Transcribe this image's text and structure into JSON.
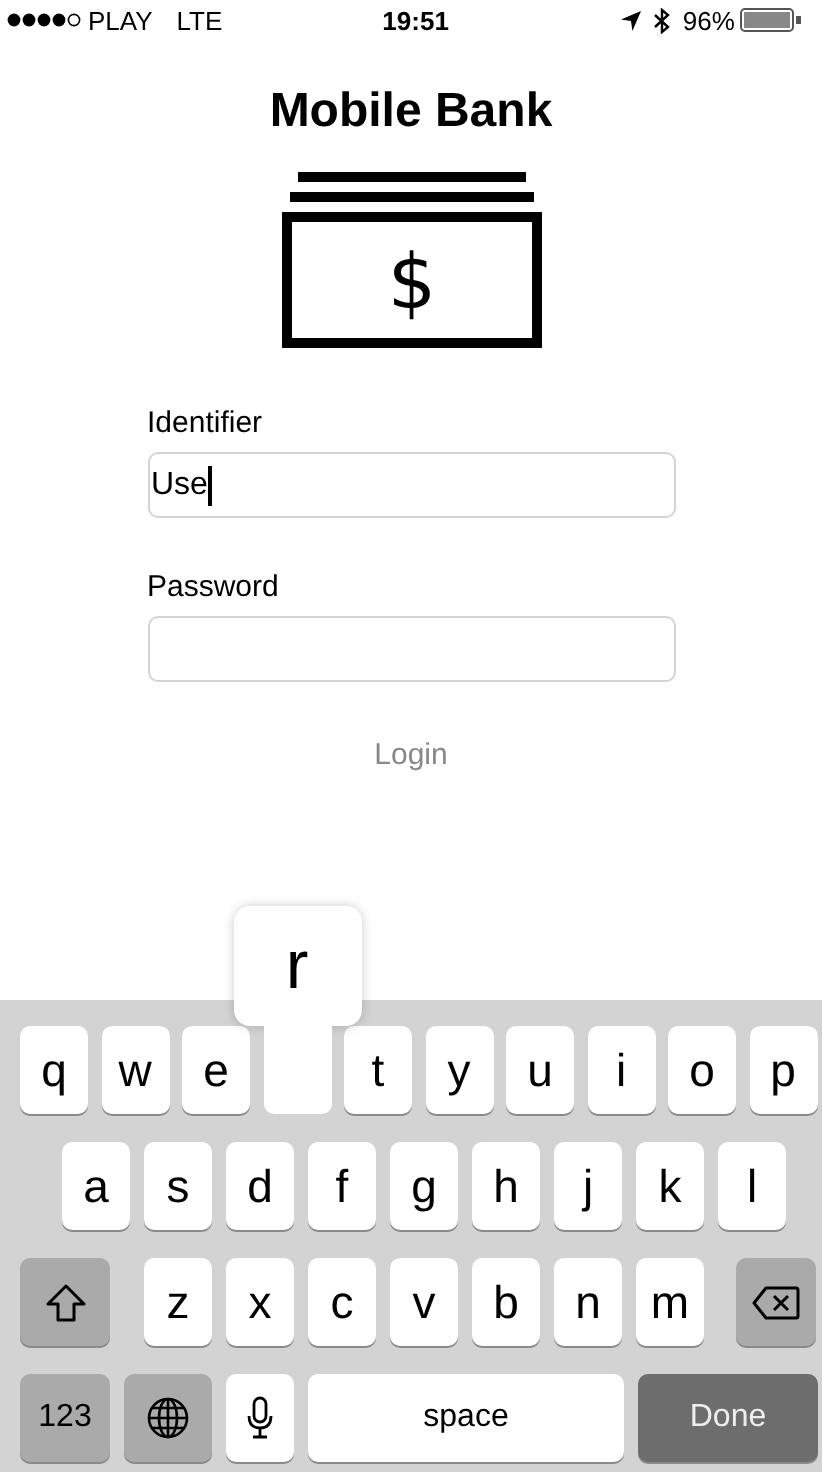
{
  "status_bar": {
    "carrier": "PLAY",
    "network": "LTE",
    "time": "19:51",
    "battery": "96%"
  },
  "title": "Mobile Bank",
  "logo_symbol": "$",
  "fields": [
    {
      "label": "Identifier",
      "value": "Use",
      "focused": true
    },
    {
      "label": "Password",
      "focused": false
    }
  ],
  "login_button": "Login",
  "keyboard": {
    "top_row": [
      {
        "kind": "letter",
        "label": "q",
        "pressed": false
      },
      {
        "kind": "letter",
        "label": "w",
        "pressed": false
      },
      {
        "kind": "letter",
        "label": "e",
        "pressed": false
      },
      {
        "kind": "letter",
        "label": "r",
        "pressed": true
      },
      {
        "kind": "letter",
        "label": "t",
        "pressed": false
      },
      {
        "kind": "letter",
        "label": "y",
        "pressed": false
      },
      {
        "kind": "letter",
        "label": "u",
        "pressed": false
      },
      {
        "kind": "letter",
        "label": "i",
        "pressed": false
      },
      {
        "kind": "letter",
        "label": "o",
        "pressed": false
      },
      {
        "kind": "letter",
        "label": "p",
        "pressed": false
      }
    ],
    "middle_row": [
      {
        "kind": "letter",
        "label": "a",
        "pressed": false
      },
      {
        "kind": "letter",
        "label": "s",
        "pressed": false
      },
      {
        "kind": "letter",
        "label": "d",
        "pressed": false
      },
      {
        "kind": "letter",
        "label": "f",
        "pressed": false
      },
      {
        "kind": "letter",
        "label": "g",
        "pressed": false
      },
      {
        "kind": "letter",
        "label": "h",
        "pressed": false
      },
      {
        "kind": "letter",
        "label": "j",
        "pressed": false
      },
      {
        "kind": "letter",
        "label": "k",
        "pressed": false
      },
      {
        "kind": "letter",
        "label": "l",
        "pressed": false
      }
    ],
    "lower_row": [
      {
        "kind": "shift"
      },
      {
        "kind": "letter",
        "label": "z",
        "pressed": false
      },
      {
        "kind": "letter",
        "label": "x",
        "pressed": false
      },
      {
        "kind": "letter",
        "label": "c",
        "pressed": false
      },
      {
        "kind": "letter",
        "label": "v",
        "pressed": false
      },
      {
        "kind": "letter",
        "label": "b",
        "pressed": false
      },
      {
        "kind": "letter",
        "label": "n",
        "pressed": false
      },
      {
        "kind": "letter",
        "label": "m",
        "pressed": false
      },
      {
        "kind": "delete"
      }
    ],
    "bottom_row": [
      {
        "kind": "numbers",
        "label": "123"
      },
      {
        "kind": "globe"
      },
      {
        "kind": "mic"
      },
      {
        "kind": "space",
        "label": "space"
      },
      {
        "kind": "done",
        "label": "Done"
      }
    ]
  }
}
